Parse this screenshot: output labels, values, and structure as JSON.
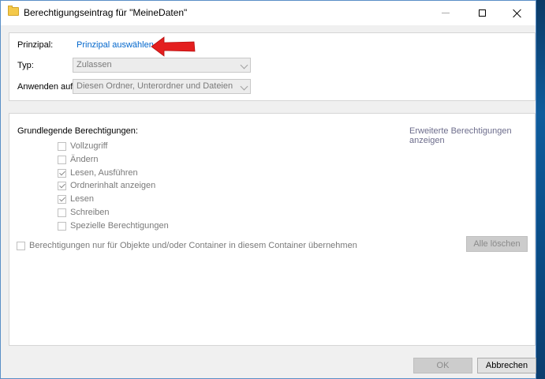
{
  "window": {
    "title": "Berechtigungseintrag für \"MeineDaten\""
  },
  "principal": {
    "label": "Prinzipal:",
    "link": "Prinzipal auswählen"
  },
  "type": {
    "label": "Typ:",
    "value": "Zulassen"
  },
  "apply_to": {
    "label": "Anwenden auf:",
    "value": "Diesen Ordner, Unterordner und Dateien"
  },
  "permissions": {
    "heading": "Grundlegende Berechtigungen:",
    "advanced_link": "Erweiterte Berechtigungen anzeigen",
    "items": [
      {
        "label": "Vollzugriff",
        "checked": false
      },
      {
        "label": "Ändern",
        "checked": false
      },
      {
        "label": "Lesen, Ausführen",
        "checked": true
      },
      {
        "label": "Ordnerinhalt anzeigen",
        "checked": true
      },
      {
        "label": "Lesen",
        "checked": true
      },
      {
        "label": "Schreiben",
        "checked": false
      },
      {
        "label": "Spezielle Berechtigungen",
        "checked": false
      }
    ],
    "inherit_label": "Berechtigungen nur für Objekte und/oder Container in diesem Container übernehmen",
    "inherit_checked": false,
    "clear_all": "Alle löschen"
  },
  "footer": {
    "ok": "OK",
    "cancel": "Abbrechen"
  },
  "colors": {
    "link": "#0066cc",
    "arrow": "#e41e1e",
    "title_bar": "#ffffff",
    "dialog_bg": "#f0f0f0"
  }
}
